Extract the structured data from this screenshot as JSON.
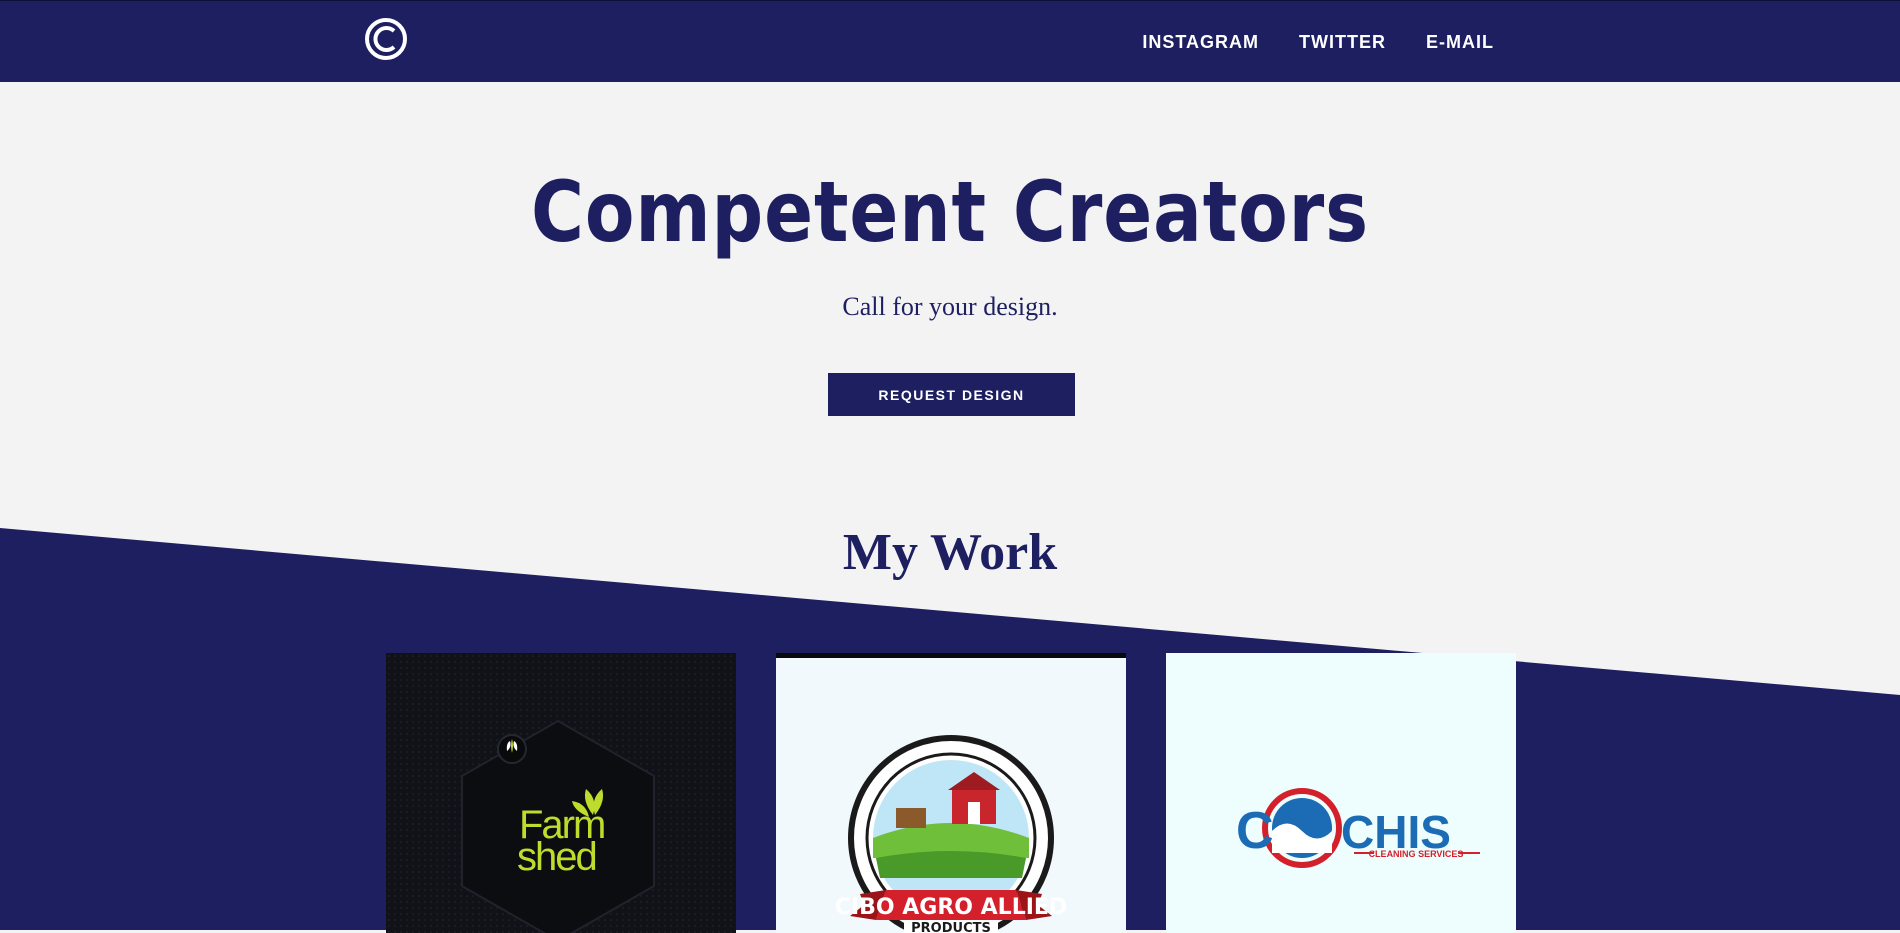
{
  "nav": {
    "logo_icon": "copyright-c-logo-icon",
    "links": [
      {
        "label": "INSTAGRAM"
      },
      {
        "label": "TWITTER"
      },
      {
        "label": "E-MAIL"
      }
    ]
  },
  "hero": {
    "title": "Competent Creators",
    "subtitle": "Call for your design.",
    "button_label": "REQUEST DESIGN"
  },
  "work": {
    "title": "My Work",
    "items": [
      {
        "name": "Farmshed",
        "line1": "Farm",
        "line2": "shed"
      },
      {
        "name": "Cibo Agro Allied Products",
        "banner": "CIBO AGRO ALLIED",
        "products": "PRODUCTS"
      },
      {
        "name": "Cochis Cleaning Services",
        "word_left": "C",
        "word_right": "CHIS",
        "tagline": "CLEANING SERVICES"
      }
    ]
  },
  "colors": {
    "navy": "#1e1f61",
    "light_bg": "#f3f3f3",
    "white": "#ffffff",
    "farmshed_green": "#bddc2c",
    "cibo_red": "#d4202a",
    "cochis_blue": "#1b6cb5"
  }
}
